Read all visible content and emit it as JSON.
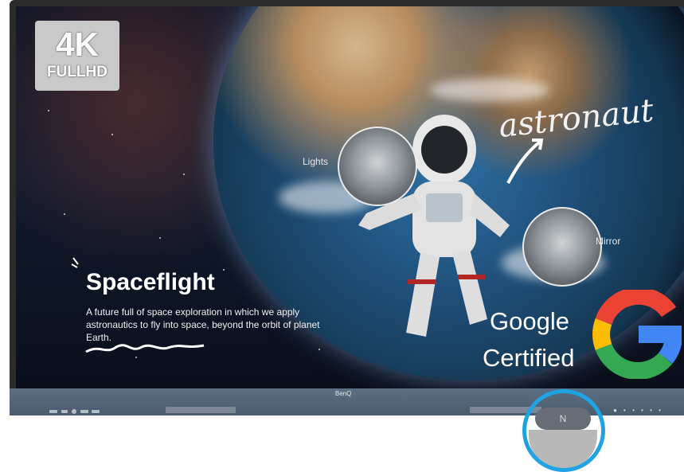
{
  "badge": {
    "resolution": "4K",
    "format": "FULLHD"
  },
  "callouts": {
    "lights": "Lights",
    "mirror": "Mirror",
    "handwritten": "astronaut"
  },
  "slide": {
    "title": "Spaceflight",
    "description": "A future full of space exploration in which we apply astronautics to fly into space, beyond the orbit of planet Earth."
  },
  "certification": {
    "line1": "Google",
    "line2": "Certified",
    "logo_colors": {
      "red": "#ea4335",
      "yellow": "#fbbc05",
      "green": "#34a853",
      "blue": "#4285f4"
    }
  },
  "device": {
    "brand": "BenQ",
    "nfc_label": "N",
    "highlight_color": "#1fa3e3"
  }
}
